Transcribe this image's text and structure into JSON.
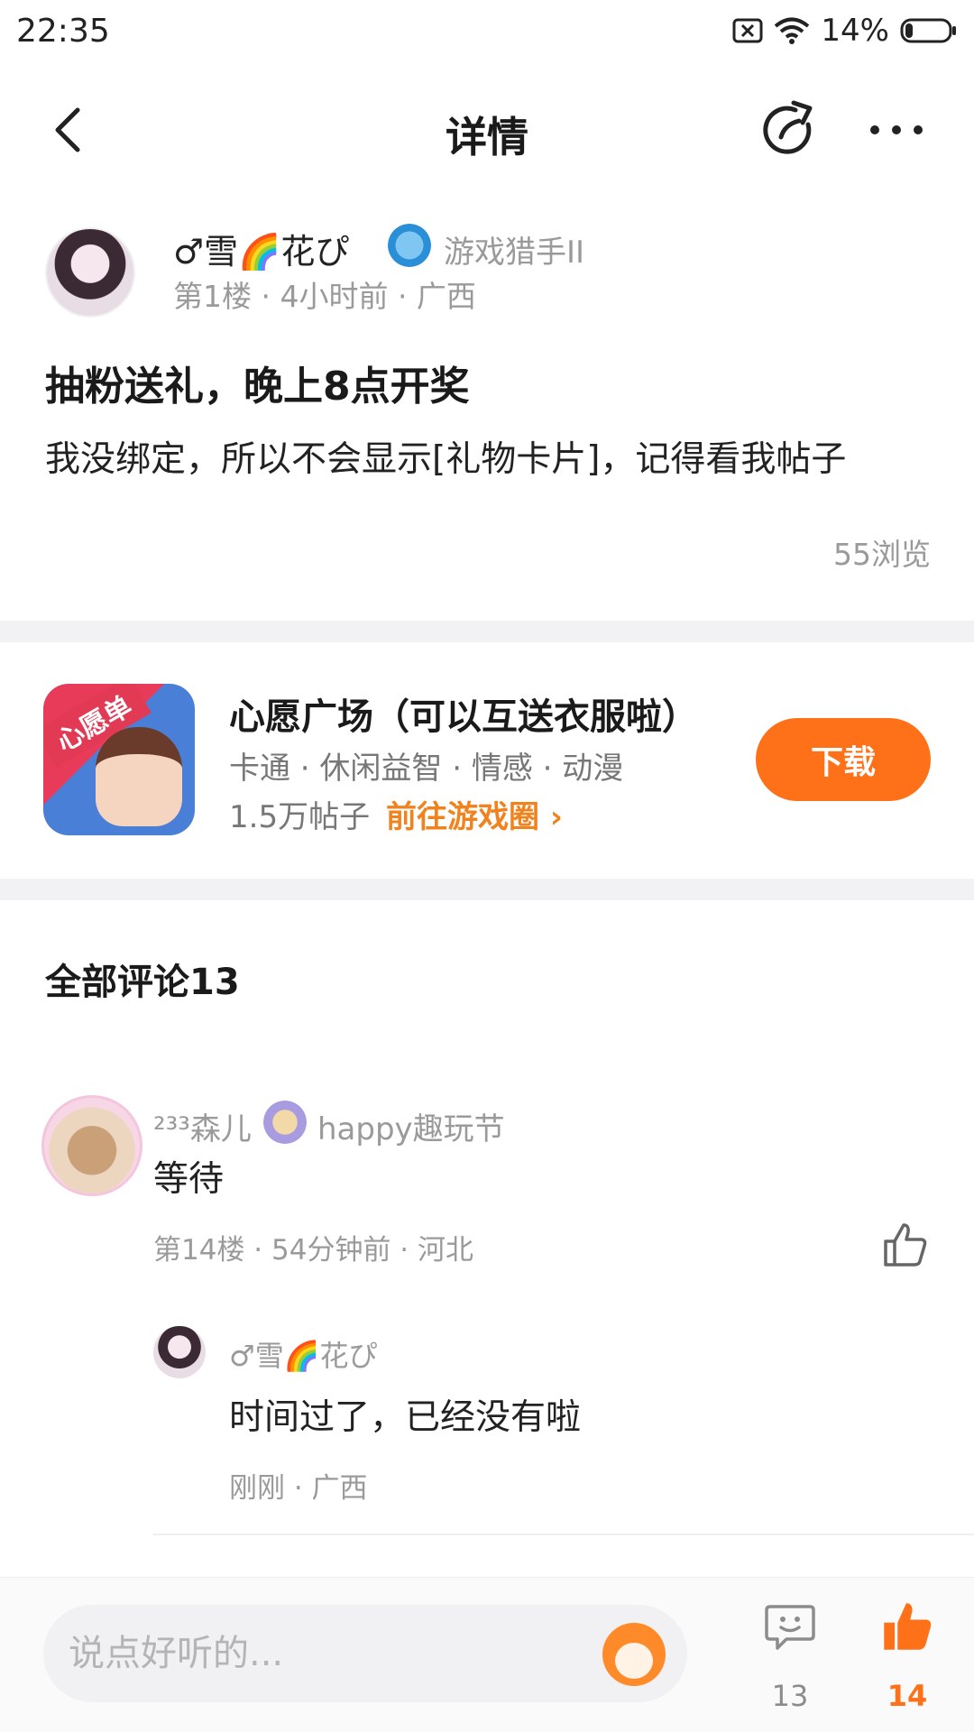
{
  "status_bar": {
    "time": "22:35",
    "battery": "14%"
  },
  "header": {
    "title": "详情"
  },
  "post": {
    "author_name": "♂雪🌈花ぴ",
    "author_badge": "游戏猎手II",
    "meta": "第1楼 · 4小时前 · 广西",
    "title": "抽粉送礼，晚上8点开奖",
    "body": "我没绑定，所以不会显示[礼物卡片]，记得看我帖子",
    "views": "55浏览"
  },
  "game_card": {
    "icon_tag": "心愿单",
    "name": "心愿广场（可以互送衣服啦）",
    "tags": "卡通 · 休闲益智 · 情感 · 动漫",
    "posts": "1.5万帖子",
    "link": "前往游戏圈 ›",
    "download_label": "下载"
  },
  "comments": {
    "title": "全部评论13",
    "items": [
      {
        "name": "²³³森儿",
        "badge": "happy趣玩节",
        "text": "等待",
        "meta": "第14楼 · 54分钟前 · 河北",
        "reply": {
          "name": "♂雪🌈花ぴ",
          "text": "时间过了，已经没有啦",
          "meta": "刚刚 · 广西"
        }
      }
    ]
  },
  "bottom_bar": {
    "input_placeholder": "说点好听的...",
    "comment_count": "13",
    "like_count": "14"
  },
  "colors": {
    "accent": "#ff7118",
    "link": "#f0831e",
    "muted": "#9a9a9a"
  },
  "icons": [
    "wifi-icon",
    "battery-icon",
    "sim-off-icon",
    "back-icon",
    "share-icon",
    "more-icon",
    "like-icon",
    "comment-icon",
    "mascot-icon"
  ]
}
